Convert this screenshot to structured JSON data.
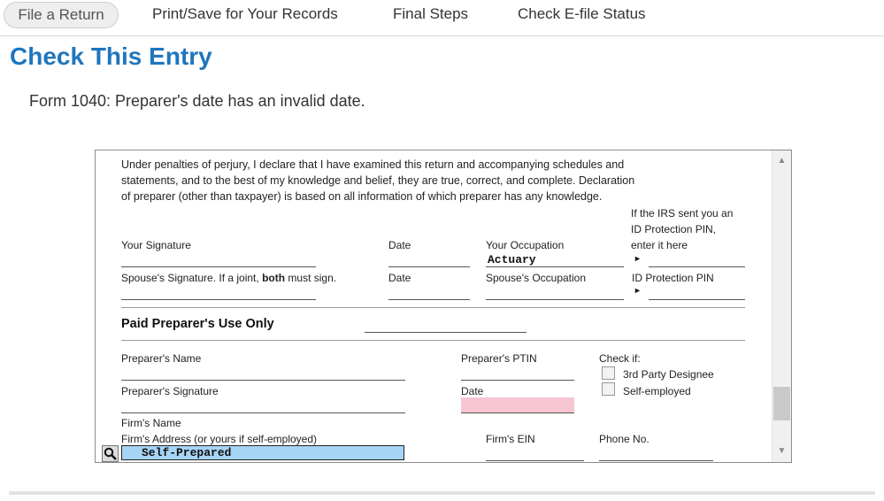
{
  "nav": {
    "tabs": [
      {
        "label": "File a Return"
      },
      {
        "label": "Print/Save for Your Records"
      },
      {
        "label": "Final Steps"
      },
      {
        "label": "Check E-file Status"
      }
    ]
  },
  "page": {
    "title": "Check This Entry",
    "error_message": "Form 1040: Preparer's date has an invalid date."
  },
  "form": {
    "declaration_line1": "Under penalties of perjury, I declare that I have examined this return and accompanying schedules and",
    "declaration_line2": "statements, and to the best of my knowledge and belief, they are true, correct, and complete. Declaration",
    "declaration_line3": "of preparer (other than taxpayer) is based on all information of which preparer has any knowledge.",
    "ip_pin_note_line1": "If the IRS sent you an",
    "ip_pin_note_line2": "ID Protection PIN,",
    "ip_pin_note_line3": "enter it here",
    "your_signature_label": "Your Signature",
    "date_label": "Date",
    "your_occupation_label": "Your Occupation",
    "your_occupation_value": "Actuary",
    "spouse_signature_prefix": "Spouse's Signature. If a joint, ",
    "spouse_signature_bold": "both",
    "spouse_signature_suffix": " must sign.",
    "spouse_date_label": "Date",
    "spouse_occupation_label": "Spouse's Occupation",
    "id_protection_pin_label": "ID Protection PIN",
    "paid_preparer_heading": "Paid Preparer's Use Only",
    "preparer_name_label": "Preparer's Name",
    "preparer_ptin_label": "Preparer's  PTIN",
    "check_if_label": "Check if:",
    "third_party_label": "3rd Party Designee",
    "preparer_signature_label": "Preparer's Signature",
    "preparer_date_label": "Date",
    "self_employed_label": "Self-employed",
    "firm_name_label": "Firm's Name",
    "firm_address_label": "Firm's Address (or yours if self-employed)",
    "firm_ein_label": "Firm's EIN",
    "phone_label": "Phone No.",
    "firm_name_value": "Self-Prepared"
  },
  "colors": {
    "title_blue": "#1f76bd",
    "invalid_field": "#f7c5d2",
    "active_field": "#a6d4f5"
  }
}
